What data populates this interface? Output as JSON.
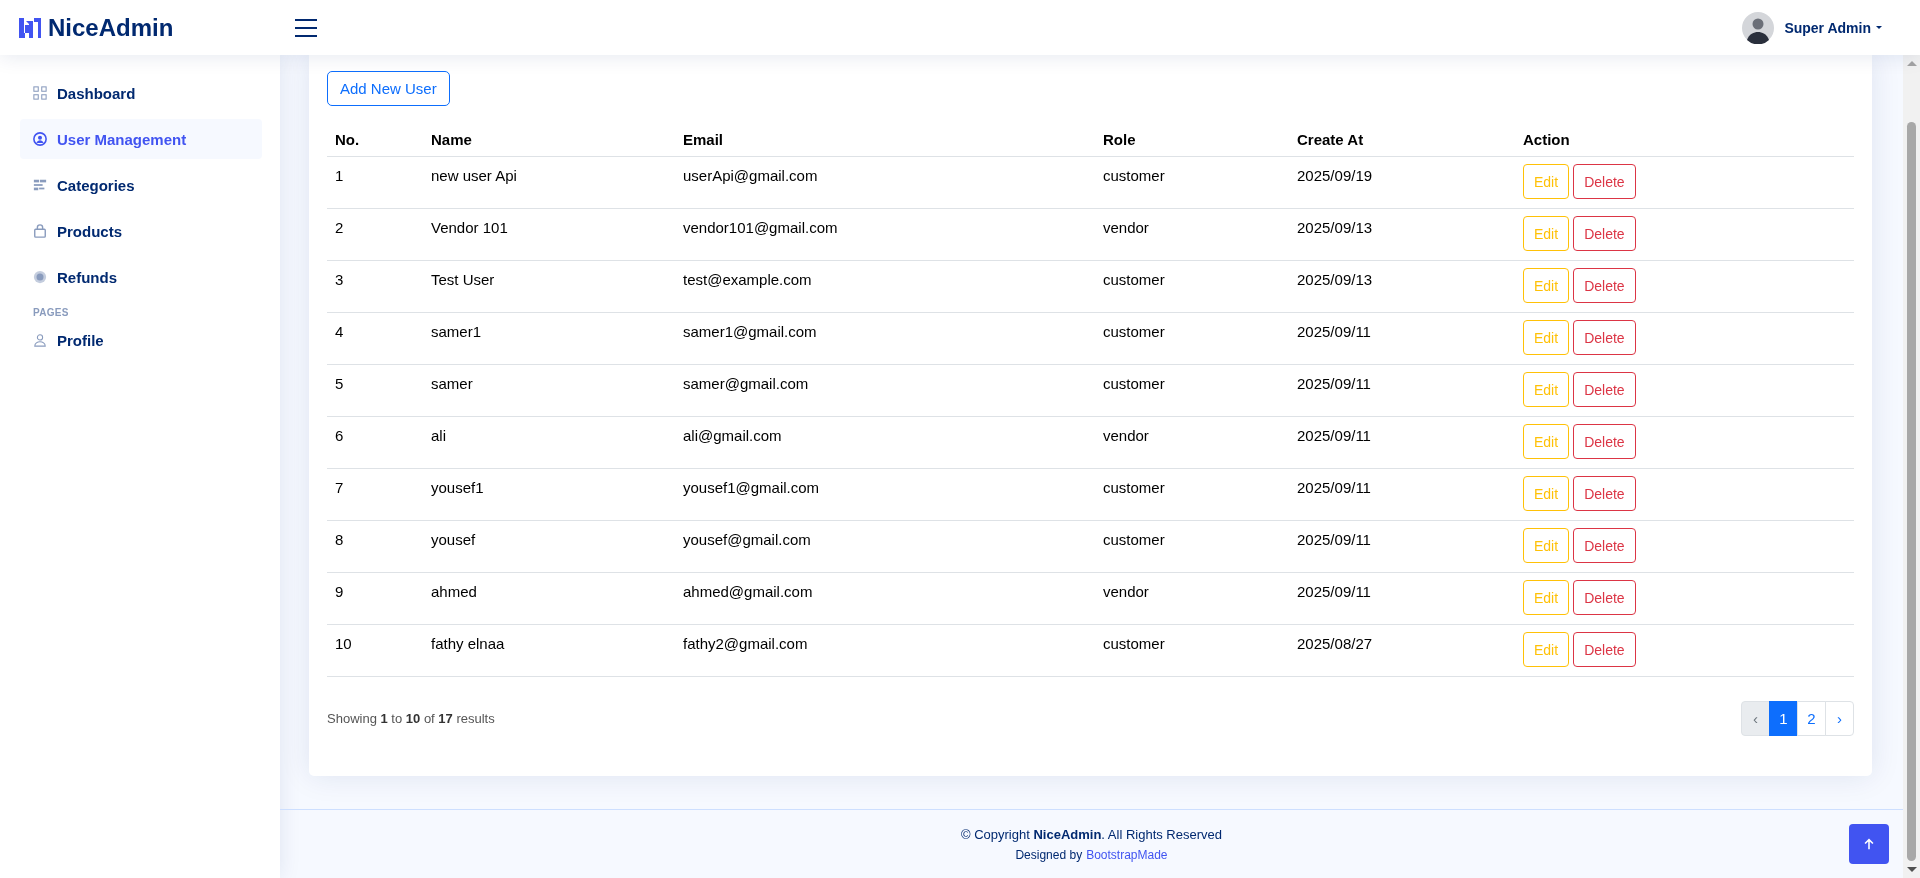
{
  "header": {
    "logo": "NiceAdmin",
    "user": "Super Admin"
  },
  "sidebar": {
    "items": [
      {
        "label": "Dashboard",
        "kind": "grid",
        "selected": false
      },
      {
        "label": "User Management",
        "kind": "user-circle",
        "selected": true
      },
      {
        "label": "Categories",
        "kind": "list",
        "selected": false
      },
      {
        "label": "Products",
        "kind": "bag",
        "selected": false
      },
      {
        "label": "Refunds",
        "kind": "coin",
        "selected": false
      }
    ],
    "section": "PAGES",
    "pages": [
      {
        "label": "Profile",
        "kind": "person",
        "selected": false
      }
    ]
  },
  "add_button": "Add New User",
  "table": {
    "columns": [
      "No.",
      "Name",
      "Email",
      "Role",
      "Create At",
      "Action"
    ],
    "rows": [
      {
        "no": "1",
        "name": "new user Api",
        "email": "userApi@gmail.com",
        "role": "customer",
        "created": "2025/09/19",
        "edit": "Edit",
        "delete": "Delete"
      },
      {
        "no": "2",
        "name": "Vendor 101",
        "email": "vendor101@gmail.com",
        "role": "vendor",
        "created": "2025/09/13",
        "edit": "Edit",
        "delete": "Delete"
      },
      {
        "no": "3",
        "name": "Test User",
        "email": "test@example.com",
        "role": "customer",
        "created": "2025/09/13",
        "edit": "Edit",
        "delete": "Delete"
      },
      {
        "no": "4",
        "name": "samer1",
        "email": "samer1@gmail.com",
        "role": "customer",
        "created": "2025/09/11",
        "edit": "Edit",
        "delete": "Delete"
      },
      {
        "no": "5",
        "name": "samer",
        "email": "samer@gmail.com",
        "role": "customer",
        "created": "2025/09/11",
        "edit": "Edit",
        "delete": "Delete"
      },
      {
        "no": "6",
        "name": "ali",
        "email": "ali@gmail.com",
        "role": "vendor",
        "created": "2025/09/11",
        "edit": "Edit",
        "delete": "Delete"
      },
      {
        "no": "7",
        "name": "yousef1",
        "email": "yousef1@gmail.com",
        "role": "customer",
        "created": "2025/09/11",
        "edit": "Edit",
        "delete": "Delete"
      },
      {
        "no": "8",
        "name": "yousef",
        "email": "yousef@gmail.com",
        "role": "customer",
        "created": "2025/09/11",
        "edit": "Edit",
        "delete": "Delete"
      },
      {
        "no": "9",
        "name": "ahmed",
        "email": "ahmed@gmail.com",
        "role": "vendor",
        "created": "2025/09/11",
        "edit": "Edit",
        "delete": "Delete"
      },
      {
        "no": "10",
        "name": "fathy elnaa",
        "email": "fathy2@gmail.com",
        "role": "customer",
        "created": "2025/08/27",
        "edit": "Edit",
        "delete": "Delete"
      }
    ]
  },
  "summary": "Showing **1** to **10** of **17** results",
  "pagination": [
    {
      "label": "‹",
      "kind": "prev",
      "disabled": true,
      "selected": false
    },
    {
      "label": "1",
      "kind": "page",
      "disabled": false,
      "selected": true
    },
    {
      "label": "2",
      "kind": "page",
      "disabled": false,
      "selected": false
    },
    {
      "label": "›",
      "kind": "next",
      "disabled": false,
      "selected": false
    }
  ],
  "footer": {
    "copyright": "© Copyright **NiceAdmin**. All Rights Reserved",
    "credit_text": "Designed by",
    "credit_link": "BootstrapMade"
  }
}
